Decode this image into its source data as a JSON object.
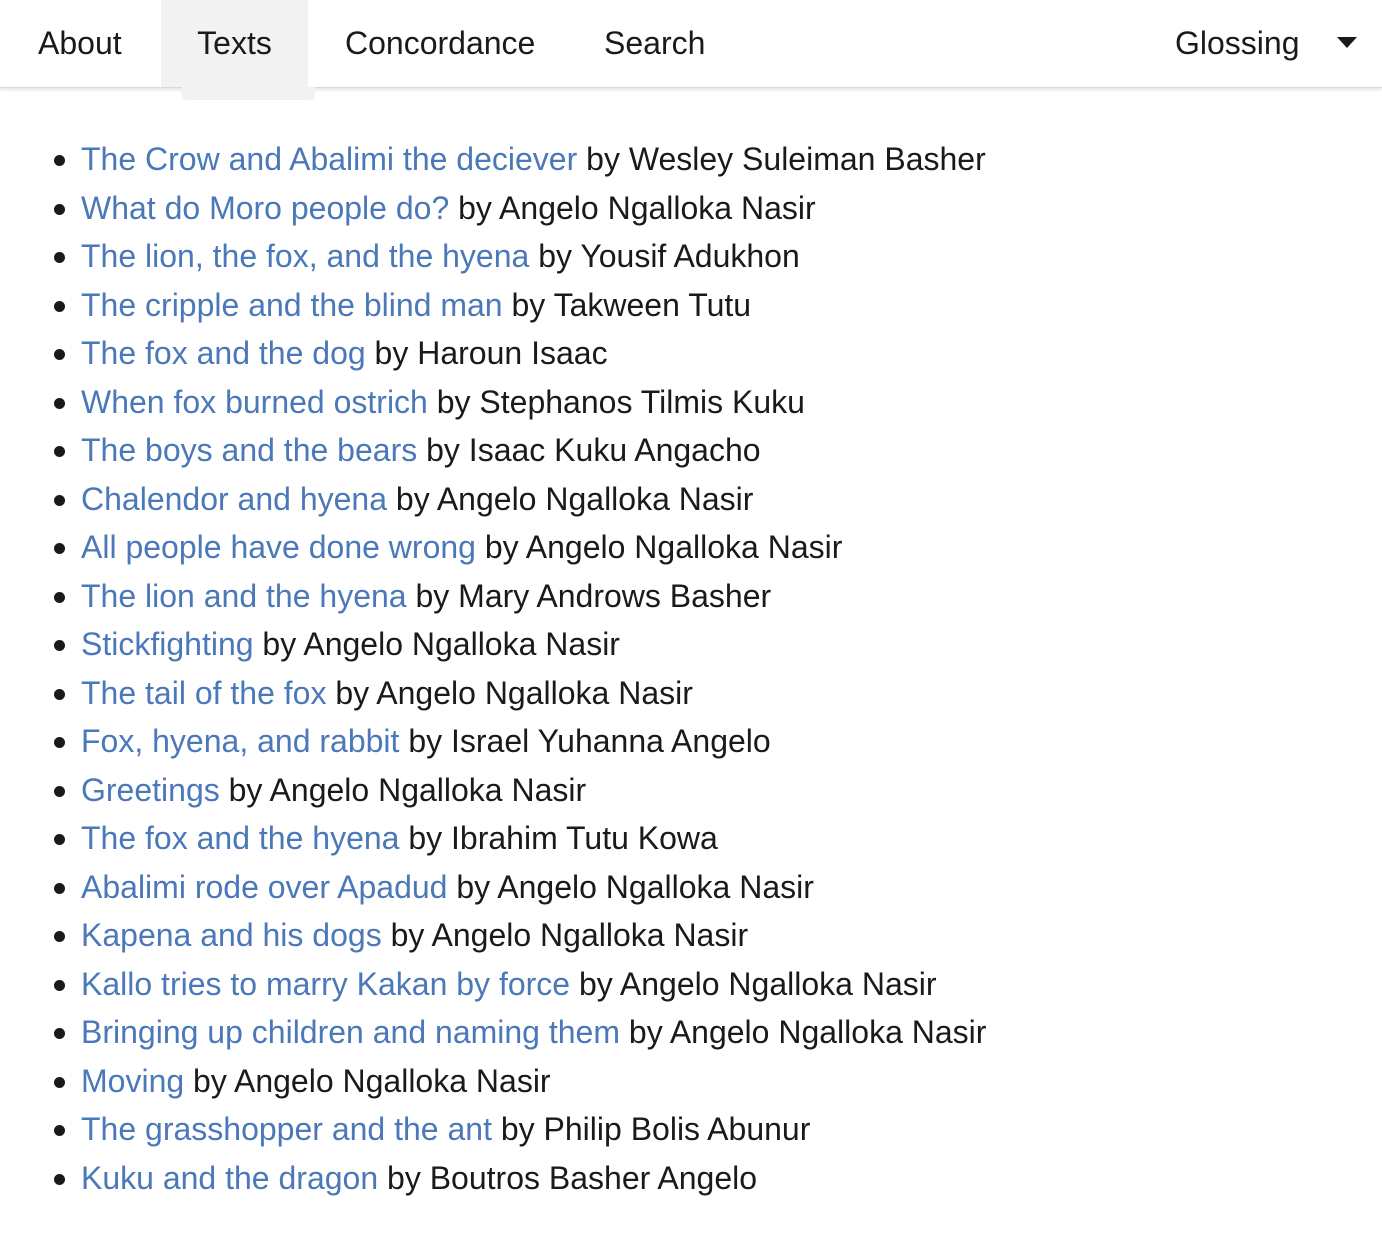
{
  "nav": {
    "about": "About",
    "texts": "Texts",
    "concordance": "Concordance",
    "search": "Search",
    "glossing": "Glossing"
  },
  "colors": {
    "link": "#4a78b8",
    "active_tab_bg": "#f2f2f2",
    "text": "#1a1a1a"
  },
  "texts": [
    {
      "title": "The Crow and Abalimi the deciever",
      "author": "by Wesley Suleiman Basher"
    },
    {
      "title": "What do Moro people do?",
      "author": "by Angelo Ngalloka Nasir"
    },
    {
      "title": "The lion, the fox, and the hyena",
      "author": "by Yousif Adukhon"
    },
    {
      "title": "The cripple and the blind man",
      "author": "by Takween Tutu"
    },
    {
      "title": "The fox and the dog",
      "author": "by Haroun Isaac"
    },
    {
      "title": "When fox burned ostrich",
      "author": "by Stephanos Tilmis Kuku"
    },
    {
      "title": "The boys and the bears",
      "author": "by Isaac Kuku Angacho"
    },
    {
      "title": "Chalendor and hyena",
      "author": "by Angelo Ngalloka Nasir"
    },
    {
      "title": "All people have done wrong",
      "author": "by Angelo Ngalloka Nasir"
    },
    {
      "title": "The lion and the hyena",
      "author": "by Mary Androws Basher"
    },
    {
      "title": "Stickfighting",
      "author": "by Angelo Ngalloka Nasir"
    },
    {
      "title": "The tail of the fox",
      "author": "by Angelo Ngalloka Nasir"
    },
    {
      "title": "Fox, hyena, and rabbit",
      "author": "by Israel Yuhanna Angelo"
    },
    {
      "title": "Greetings",
      "author": "by Angelo Ngalloka Nasir"
    },
    {
      "title": "The fox and the hyena",
      "author": "by Ibrahim Tutu Kowa"
    },
    {
      "title": "Abalimi rode over Apadud",
      "author": "by Angelo Ngalloka Nasir"
    },
    {
      "title": "Kapena and his dogs",
      "author": "by Angelo Ngalloka Nasir"
    },
    {
      "title": "Kallo tries to marry Kakan by force",
      "author": "by Angelo Ngalloka Nasir"
    },
    {
      "title": "Bringing up children and naming them",
      "author": "by Angelo Ngalloka Nasir"
    },
    {
      "title": "Moving",
      "author": "by Angelo Ngalloka Nasir"
    },
    {
      "title": "The grasshopper and the ant",
      "author": "by Philip Bolis Abunur"
    },
    {
      "title": "Kuku and the dragon",
      "author": "by Boutros Basher Angelo"
    }
  ]
}
